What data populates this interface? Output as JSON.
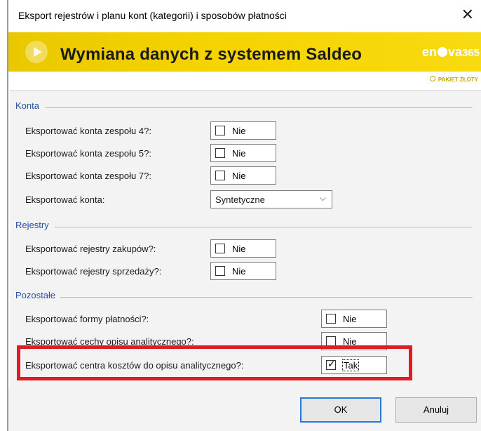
{
  "window": {
    "title": "Eksport rejestrów i planu kont (kategorii) i sposobów płatności",
    "close_symbol": "✕"
  },
  "banner": {
    "heading": "Wymiana danych z systemem Saldeo",
    "logo_left": "en",
    "logo_right": "va",
    "logo_number": "365",
    "badge": "PAKIET ZŁOTY",
    "accent_color": "#f5d300"
  },
  "sections": {
    "konta": {
      "title": "Konta",
      "rows": [
        {
          "label": "Eksportować konta zespołu 4?:",
          "value": "Nie",
          "checked": false
        },
        {
          "label": "Eksportować konta zespołu 5?:",
          "value": "Nie",
          "checked": false
        },
        {
          "label": "Eksportować konta zespołu 7?:",
          "value": "Nie",
          "checked": false
        }
      ],
      "select": {
        "label": "Eksportować konta:",
        "value": "Syntetyczne"
      }
    },
    "rejestry": {
      "title": "Rejestry",
      "rows": [
        {
          "label": "Eksportować rejestry zakupów?:",
          "value": "Nie",
          "checked": false
        },
        {
          "label": "Eksportować rejestry sprzedaży?:",
          "value": "Nie",
          "checked": false
        }
      ]
    },
    "pozostale": {
      "title": "Pozostałe",
      "rows": [
        {
          "label": "Eksportować formy płatności?:",
          "value": "Nie",
          "checked": false
        },
        {
          "label": "Eksportować cechy opisu analitycznego?:",
          "value": "Nie",
          "checked": false
        },
        {
          "label": "Eksportować centra kosztów do opisu analitycznego?:",
          "value": "Tak",
          "checked": true
        }
      ]
    }
  },
  "footer": {
    "ok_label": "OK",
    "cancel_label": "Anuluj"
  },
  "icons": {
    "play": "play-icon",
    "checkmark": "✓",
    "chevron": "⌵"
  },
  "colors": {
    "section_title": "#2b4ea3",
    "highlight": "#e11b22",
    "ok_border": "#2a78d6"
  }
}
